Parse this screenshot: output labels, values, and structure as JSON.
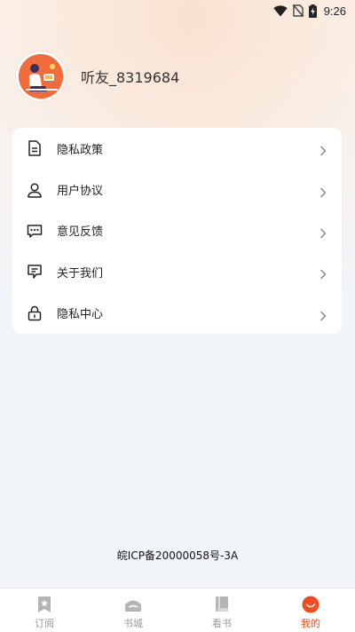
{
  "status_bar": {
    "time": "9:26"
  },
  "profile": {
    "username": "听友_8319684"
  },
  "menu": {
    "items": [
      {
        "label": "隐私政策",
        "icon": "document-icon"
      },
      {
        "label": "用户协议",
        "icon": "user-icon"
      },
      {
        "label": "意见反馈",
        "icon": "feedback-chat-icon"
      },
      {
        "label": "关于我们",
        "icon": "info-chat-icon"
      },
      {
        "label": "隐私中心",
        "icon": "lock-icon"
      }
    ]
  },
  "footer": {
    "icp": "皖ICP备20000058号-3A"
  },
  "tabbar": {
    "active_color": "#ee4b1f",
    "items": [
      {
        "label": "订阅",
        "icon": "subscribe-star-icon"
      },
      {
        "label": "书城",
        "icon": "bookstore-icon"
      },
      {
        "label": "看书",
        "icon": "read-book-icon"
      },
      {
        "label": "我的",
        "icon": "profile-icon",
        "active": true
      }
    ]
  }
}
